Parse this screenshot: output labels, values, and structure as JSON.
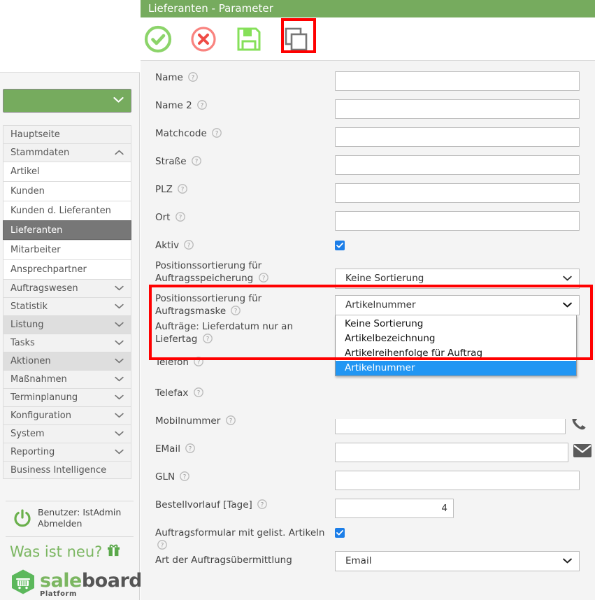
{
  "window": {
    "title": "Lieferanten - Parameter"
  },
  "colors": {
    "brand_green": "#76ab5e",
    "accent_blue": "#2196f3",
    "checkbox_blue": "#1c7ee8",
    "highlight_red": "#ff0000",
    "sidebar_active": "#777777"
  },
  "toolbar": {
    "buttons": [
      {
        "name": "confirm",
        "icon": "check-circle-icon",
        "label": "OK",
        "highlighted": true
      },
      {
        "name": "cancel",
        "icon": "cancel-circle-icon",
        "label": "Abbrechen",
        "highlighted": false
      },
      {
        "name": "save",
        "icon": "floppy-disk-icon",
        "label": "Speichern",
        "highlighted": false
      },
      {
        "name": "copy",
        "icon": "copy-icon",
        "label": "Kopieren",
        "highlighted": false
      }
    ]
  },
  "sidebar": {
    "company_select": {
      "value": "",
      "icon": "chevron-down-icon"
    },
    "nav": [
      {
        "label": "Hauptseite",
        "type": "group",
        "arrow": "",
        "shaded": false
      },
      {
        "label": "Stammdaten",
        "type": "group",
        "arrow": "chevron-up-icon",
        "shaded": false
      },
      {
        "label": "Artikel",
        "type": "child",
        "active": false
      },
      {
        "label": "Kunden",
        "type": "child",
        "active": false
      },
      {
        "label": "Kunden d. Lieferanten",
        "type": "child",
        "active": false
      },
      {
        "label": "Lieferanten",
        "type": "child",
        "active": true
      },
      {
        "label": "Mitarbeiter",
        "type": "child",
        "active": false
      },
      {
        "label": "Ansprechpartner",
        "type": "child",
        "active": false
      },
      {
        "label": "Auftragswesen",
        "type": "group",
        "arrow": "chevron-down-icon",
        "shaded": false
      },
      {
        "label": "Statistik",
        "type": "group",
        "arrow": "chevron-down-icon",
        "shaded": false
      },
      {
        "label": "Listung",
        "type": "group",
        "arrow": "chevron-down-icon",
        "shaded": true
      },
      {
        "label": "Tasks",
        "type": "group",
        "arrow": "chevron-down-icon",
        "shaded": false
      },
      {
        "label": "Aktionen",
        "type": "group",
        "arrow": "chevron-down-icon",
        "shaded": true
      },
      {
        "label": "Maßnahmen",
        "type": "group",
        "arrow": "chevron-down-icon",
        "shaded": false
      },
      {
        "label": "Terminplanung",
        "type": "group",
        "arrow": "chevron-down-icon",
        "shaded": false
      },
      {
        "label": "Konfiguration",
        "type": "group",
        "arrow": "chevron-down-icon",
        "shaded": false
      },
      {
        "label": "System",
        "type": "group",
        "arrow": "chevron-down-icon",
        "shaded": false
      },
      {
        "label": "Reporting",
        "type": "group",
        "arrow": "chevron-down-icon",
        "shaded": false
      },
      {
        "label": "Business Intelligence",
        "type": "group",
        "arrow": "",
        "shaded": false
      }
    ],
    "footer": {
      "user_line1": "Benutzer: IstAdmin",
      "user_line2": "Abmelden",
      "power_icon": "power-icon",
      "whats_new": "Was ist neu?",
      "gift_icon": "gift-icon",
      "brand_part1": "sale",
      "brand_part2": "board",
      "brand_sub": "Platform",
      "brand_icon": "shopping-cart-hex-icon"
    }
  },
  "form": {
    "help_icon": "question-circle-icon",
    "fields": [
      {
        "label": "Name",
        "help": true,
        "type": "text",
        "value": "",
        "side_icon": "keypad-icon"
      },
      {
        "label": "Name 2",
        "help": true,
        "type": "text",
        "value": ""
      },
      {
        "label": "Matchcode",
        "help": true,
        "type": "text",
        "value": ""
      },
      {
        "label": "Straße",
        "help": true,
        "type": "text",
        "value": ""
      },
      {
        "label": "PLZ",
        "help": true,
        "type": "text",
        "value": ""
      },
      {
        "label": "Ort",
        "help": true,
        "type": "text",
        "value": ""
      },
      {
        "label": "Aktiv",
        "help": true,
        "type": "checkbox",
        "checked": true
      },
      {
        "label": "Positionssortierung für Auftragsspeicherung",
        "help": true,
        "type": "select",
        "value": "Keine Sortierung"
      },
      {
        "label": "Positionssortierung für Auftragsmaske",
        "help": true,
        "type": "select-open",
        "value": "Artikelnummer"
      },
      {
        "label": "Aufträge: Lieferdatum nur an Liefertag",
        "help": true,
        "type": "checkbox-hidden",
        "checked": false
      },
      {
        "label": "Telefon",
        "help": true,
        "type": "text",
        "value": ""
      },
      {
        "label": "Telefax",
        "help": true,
        "type": "text",
        "value": ""
      },
      {
        "label": "Mobilnummer",
        "help": true,
        "type": "text",
        "value": "",
        "side_icon": "phone-icon"
      },
      {
        "label": "EMail",
        "help": true,
        "type": "text",
        "value": "",
        "side_icon": "envelope-icon"
      },
      {
        "label": "GLN",
        "help": true,
        "type": "text",
        "value": ""
      },
      {
        "label": "Bestellvorlauf [Tage]",
        "help": true,
        "type": "number",
        "value": "4"
      },
      {
        "label": "Auftragsformular mit gelist. Artikeln",
        "help": true,
        "type": "checkbox",
        "checked": true
      },
      {
        "label": "Art der Auftragsübermittlung",
        "help": false,
        "type": "select",
        "value": "Email"
      }
    ],
    "open_dropdown": {
      "selected": "Artikelnummer",
      "options": [
        "Keine Sortierung",
        "Artikelbezeichnung",
        "Artikelreihenfolge für Auftrag",
        "Artikelnummer"
      ]
    }
  }
}
